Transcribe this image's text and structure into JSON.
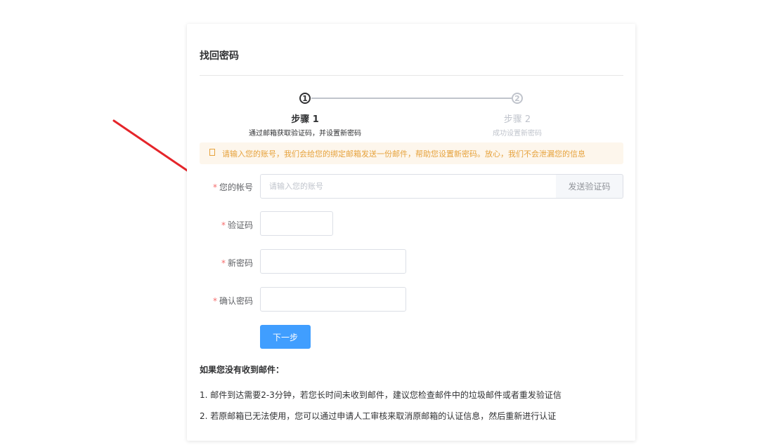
{
  "page_title": "找回密码",
  "steps": [
    {
      "number": "1",
      "title": "步骤 1",
      "description": "通过邮箱获取验证码，并设置新密码"
    },
    {
      "number": "2",
      "title": "步骤 2",
      "description": "成功设置新密码"
    }
  ],
  "alert": {
    "text": "请输入您的账号，我们会给您的绑定邮箱发送一份邮件，帮助您设置新密码。放心，我们不会泄漏您的信息"
  },
  "form": {
    "required_mark": "*",
    "account": {
      "label": "您的帐号",
      "placeholder": "请输入您的账号",
      "value": ""
    },
    "send_code_label": "发送验证码",
    "code": {
      "label": "验证码",
      "value": ""
    },
    "new_password": {
      "label": "新密码",
      "value": ""
    },
    "confirm_password": {
      "label": "确认密码",
      "value": ""
    },
    "next_label": "下一步"
  },
  "help": {
    "title": "如果您没有收到邮件：",
    "items": [
      "1. 邮件到达需要2-3分钟，若您长时间未收到邮件，建议您检查邮件中的垃圾邮件或者重发验证信",
      "2. 若原邮箱已无法使用，您可以通过申请人工审核来取消原邮箱的认证信息，然后重新进行认证"
    ]
  },
  "colors": {
    "primary": "#409eff",
    "warning_bg": "#fdf6ec",
    "warning_text": "#e6a23c",
    "required": "#f56c6c",
    "annotation_arrow": "#e5252a"
  }
}
